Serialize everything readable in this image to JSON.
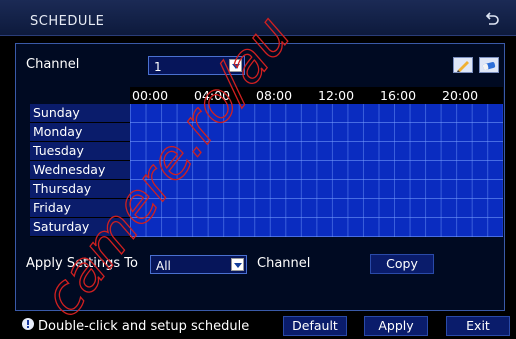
{
  "window": {
    "title": "SCHEDULE",
    "back_icon": "return-arrow-icon"
  },
  "channel": {
    "label": "Channel",
    "value": "1"
  },
  "tools": [
    {
      "icon": "pencil-icon"
    },
    {
      "icon": "eraser-icon"
    }
  ],
  "schedule": {
    "times": [
      "00:00",
      "04:00",
      "08:00",
      "12:00",
      "16:00",
      "20:00"
    ],
    "days": [
      "Sunday",
      "Monday",
      "Tuesday",
      "Wednesday",
      "Thursday",
      "Friday",
      "Saturday"
    ],
    "cell_color": "#0a2cc0"
  },
  "apply": {
    "label": "Apply Settings To",
    "value": "All",
    "suffix": "Channel",
    "copy_label": "Copy"
  },
  "footer": {
    "hint": "Double-click and setup schedule",
    "default_label": "Default",
    "apply_label": "Apply",
    "exit_label": "Exit"
  },
  "watermark": "camere.ro/au"
}
